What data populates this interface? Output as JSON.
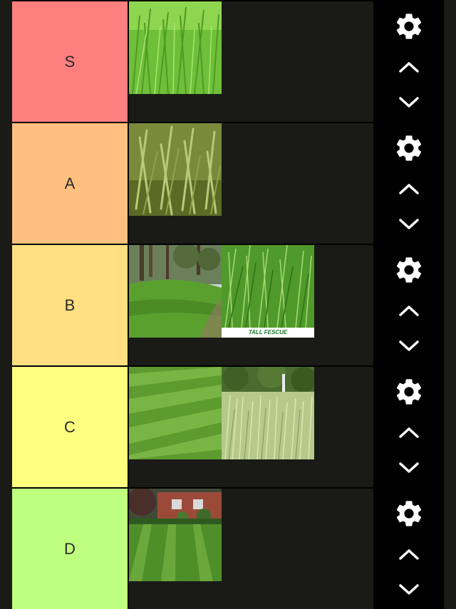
{
  "tiers": [
    {
      "label": "S",
      "color": "#ff7f7f"
    },
    {
      "label": "A",
      "color": "#ffbf7f"
    },
    {
      "label": "B",
      "color": "#ffdf80"
    },
    {
      "label": "C",
      "color": "#ffff7f"
    },
    {
      "label": "D",
      "color": "#bfff7f"
    }
  ],
  "images": {
    "s1": {
      "name": "grass-closeup-image"
    },
    "a1": {
      "name": "grass-blades-image"
    },
    "b1": {
      "name": "shaded-lawn-trees-image"
    },
    "b2": {
      "name": "tall-fescue-image",
      "caption": "TALL FESCUE"
    },
    "c1": {
      "name": "striped-lawn-image"
    },
    "c2": {
      "name": "wheat-grass-field-image"
    },
    "d1": {
      "name": "house-lawn-stripes-image"
    }
  },
  "controls": {
    "gear_icon": "gear-icon",
    "up_icon": "chevron-up-icon",
    "down_icon": "chevron-down-icon"
  }
}
